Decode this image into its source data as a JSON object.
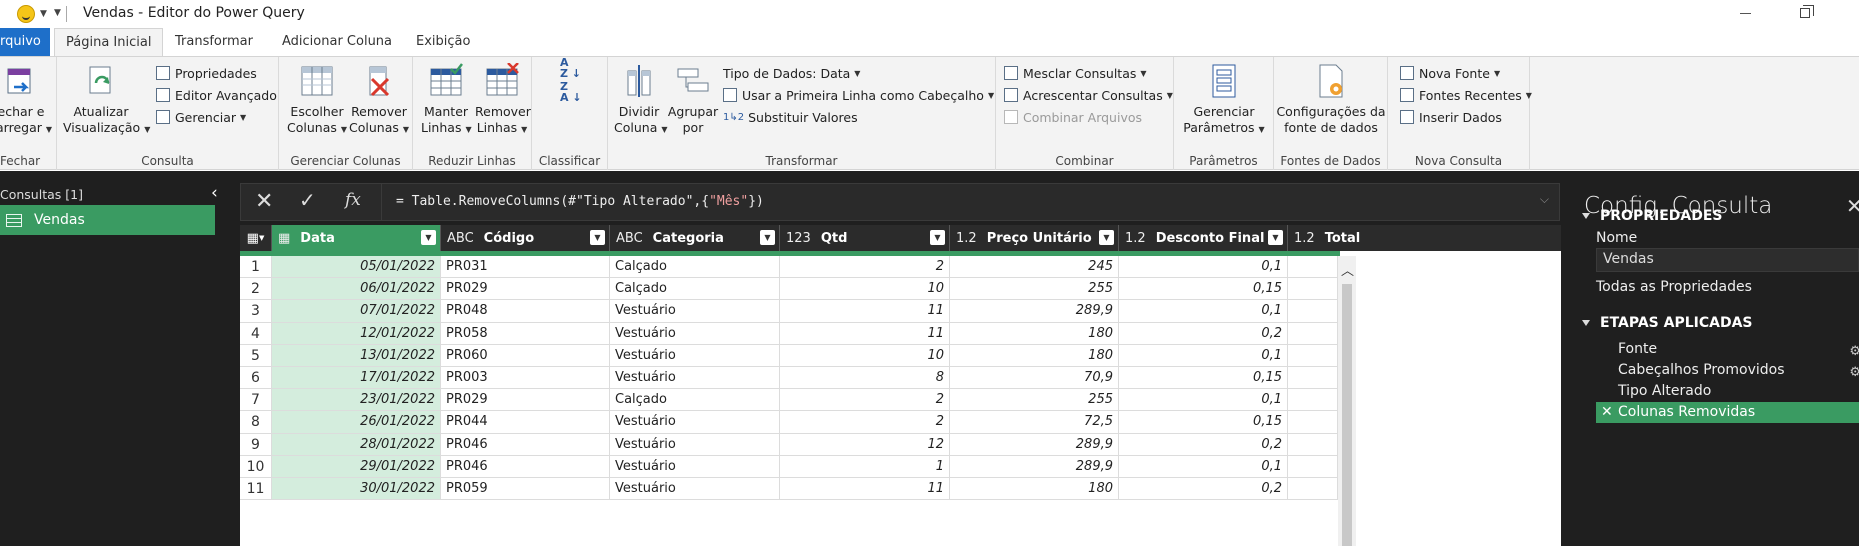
{
  "window": {
    "title": "Vendas - Editor do Power Query"
  },
  "tabs": [
    {
      "label": "rquivo"
    },
    {
      "label": "Página Inicial"
    },
    {
      "label": "Transformar"
    },
    {
      "label": "Adicionar Coluna"
    },
    {
      "label": "Exibição"
    }
  ],
  "ribbon": {
    "fechar": {
      "btn1": "echar e",
      "btn2": "arregar",
      "group": "Fechar"
    },
    "consulta": {
      "atualizar1": "Atualizar",
      "atualizar2": "Visualização",
      "propriedades": "Propriedades",
      "editor": "Editor Avançado",
      "gerenciar": "Gerenciar",
      "group": "Consulta"
    },
    "gerenciar_colunas": {
      "escolher1": "Escolher",
      "escolher2": "Colunas",
      "remover1": "Remover",
      "remover2": "Colunas",
      "group": "Gerenciar Colunas"
    },
    "reduzir_linhas": {
      "manter1": "Manter",
      "manter2": "Linhas",
      "remover1": "Remover",
      "remover2": "Linhas",
      "group": "Reduzir Linhas"
    },
    "classificar": {
      "group": "Classificar"
    },
    "transformar": {
      "dividir1": "Dividir",
      "dividir2": "Coluna",
      "agrupar1": "Agrupar",
      "agrupar2": "por",
      "tipo": "Tipo de Dados: Data",
      "primeira_linha": "Usar a Primeira Linha como Cabeçalho",
      "substituir": "Substituir Valores",
      "group": "Transformar"
    },
    "combinar": {
      "mesclar": "Mesclar Consultas",
      "acrescentar": "Acrescentar Consultas",
      "combinar_arquivos": "Combinar Arquivos",
      "group": "Combinar"
    },
    "parametros": {
      "btn1": "Gerenciar",
      "btn2": "Parâmetros",
      "group": "Parâmetros"
    },
    "fontes": {
      "btn1": "Configurações da",
      "btn2": "fonte de dados",
      "group": "Fontes de Dados"
    },
    "nova_consulta": {
      "nova_fonte": "Nova Fonte",
      "fontes_recentes": "Fontes Recentes",
      "inserir": "Inserir Dados",
      "group": "Nova Consulta"
    }
  },
  "queries": {
    "title": "Consultas [1]",
    "items": [
      "Vendas"
    ]
  },
  "formula": {
    "prefix": "= Table.RemoveColumns(#\"Tipo Alterado\",{",
    "string": "\"Mês\"",
    "suffix": "})"
  },
  "grid": {
    "columns": [
      {
        "type": "▦",
        "name": "Data"
      },
      {
        "type": "ABC",
        "name": "Código"
      },
      {
        "type": "ABC",
        "name": "Categoria"
      },
      {
        "type": "123",
        "name": "Qtd"
      },
      {
        "type": "1.2",
        "name": "Preço Unitário"
      },
      {
        "type": "1.2",
        "name": "Desconto Final"
      },
      {
        "type": "1.2",
        "name": "Total"
      }
    ],
    "rows": [
      [
        "1",
        "05/01/2022",
        "PR031",
        "Calçado",
        "2",
        "245",
        "0,1"
      ],
      [
        "2",
        "06/01/2022",
        "PR029",
        "Calçado",
        "10",
        "255",
        "0,15"
      ],
      [
        "3",
        "07/01/2022",
        "PR048",
        "Vestuário",
        "11",
        "289,9",
        "0,1"
      ],
      [
        "4",
        "12/01/2022",
        "PR058",
        "Vestuário",
        "11",
        "180",
        "0,2"
      ],
      [
        "5",
        "13/01/2022",
        "PR060",
        "Vestuário",
        "10",
        "180",
        "0,1"
      ],
      [
        "6",
        "17/01/2022",
        "PR003",
        "Vestuário",
        "8",
        "70,9",
        "0,15"
      ],
      [
        "7",
        "23/01/2022",
        "PR029",
        "Calçado",
        "2",
        "255",
        "0,1"
      ],
      [
        "8",
        "26/01/2022",
        "PR044",
        "Vestuário",
        "2",
        "72,5",
        "0,15"
      ],
      [
        "9",
        "28/01/2022",
        "PR046",
        "Vestuário",
        "12",
        "289,9",
        "0,2"
      ],
      [
        "10",
        "29/01/2022",
        "PR046",
        "Vestuário",
        "1",
        "289,9",
        "0,1"
      ],
      [
        "11",
        "30/01/2022",
        "PR059",
        "Vestuário",
        "11",
        "180",
        "0,2"
      ]
    ]
  },
  "settings": {
    "title": "Config. Consulta",
    "props_header": "PROPRIEDADES",
    "name_label": "Nome",
    "name_value": "Vendas",
    "all_props": "Todas as Propriedades",
    "steps_header": "ETAPAS APLICADAS",
    "steps": [
      "Fonte",
      "Cabeçalhos Promovidos",
      "Tipo Alterado",
      "Colunas Removidas"
    ]
  },
  "colors": {
    "accent_green": "#3a9b62",
    "file_blue": "#1e6fc9",
    "dark_bg": "#1f1f1f"
  }
}
